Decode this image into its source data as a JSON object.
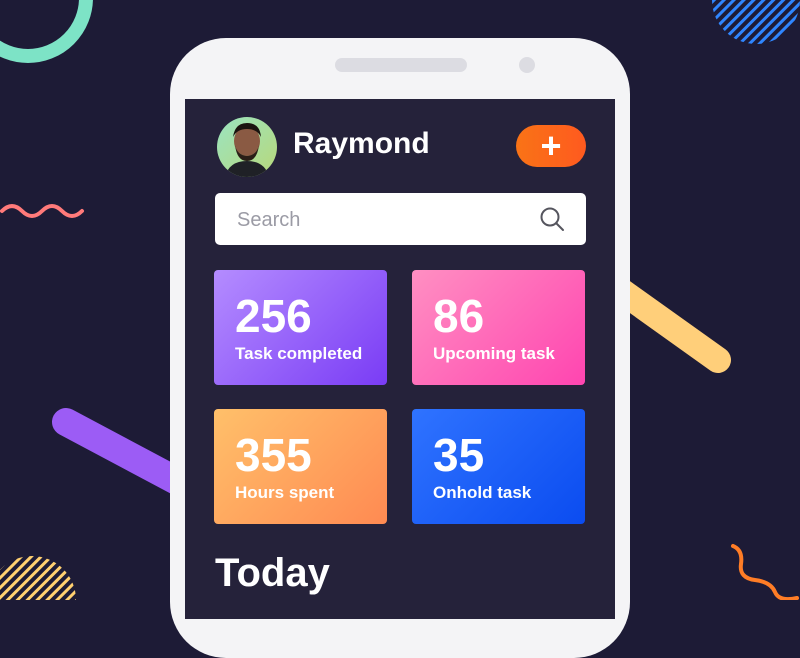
{
  "header": {
    "user_name": "Raymond",
    "add_label": "+"
  },
  "search": {
    "placeholder": "Search"
  },
  "stats": [
    {
      "value": "256",
      "label": "Task completed"
    },
    {
      "value": "86",
      "label": "Upcoming task"
    },
    {
      "value": "355",
      "label": "Hours spent"
    },
    {
      "value": "35",
      "label": "Onhold task"
    }
  ],
  "section": {
    "title": "Today"
  },
  "colors": {
    "background": "#1d1b36",
    "screen": "#25223a",
    "accent_orange": "#f97316",
    "card_purple": "#8f5cf7",
    "card_pink": "#ff5fb8",
    "card_orange": "#ffa55e",
    "card_blue": "#1f5ff8"
  },
  "icons": {
    "add": "plus-icon",
    "search": "search-icon"
  }
}
